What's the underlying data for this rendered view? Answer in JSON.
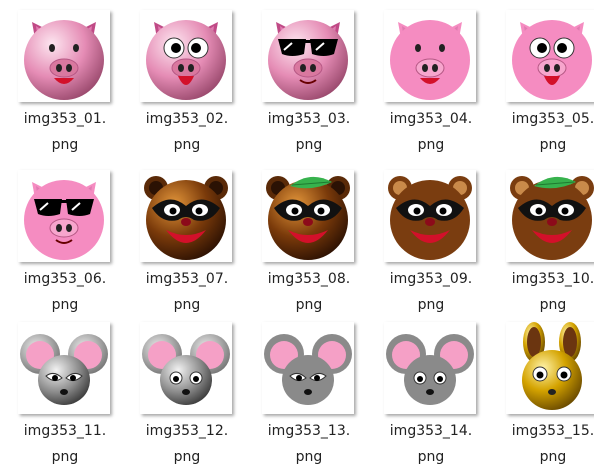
{
  "files": [
    {
      "name": "img353_01.",
      "ext": "png",
      "animal": "pig",
      "variant": "glossy-smile"
    },
    {
      "name": "img353_02.",
      "ext": "png",
      "animal": "pig",
      "variant": "glossy-googly-eyes"
    },
    {
      "name": "img353_03.",
      "ext": "png",
      "animal": "pig",
      "variant": "glossy-sunglasses"
    },
    {
      "name": "img353_04.",
      "ext": "png",
      "animal": "pig",
      "variant": "flat-smile"
    },
    {
      "name": "img353_05.",
      "ext": "png",
      "animal": "pig",
      "variant": "flat-googly-eyes"
    },
    {
      "name": "img353_06.",
      "ext": "png",
      "animal": "pig",
      "variant": "flat-sunglasses"
    },
    {
      "name": "img353_07.",
      "ext": "png",
      "animal": "tanuki",
      "variant": "glossy"
    },
    {
      "name": "img353_08.",
      "ext": "png",
      "animal": "tanuki",
      "variant": "glossy-leaf"
    },
    {
      "name": "img353_09.",
      "ext": "png",
      "animal": "tanuki",
      "variant": "flat"
    },
    {
      "name": "img353_10.",
      "ext": "png",
      "animal": "tanuki",
      "variant": "flat-leaf"
    },
    {
      "name": "img353_11.",
      "ext": "png",
      "animal": "mouse",
      "variant": "glossy"
    },
    {
      "name": "img353_12.",
      "ext": "png",
      "animal": "mouse",
      "variant": "glossy-round-eyes"
    },
    {
      "name": "img353_13.",
      "ext": "png",
      "animal": "mouse",
      "variant": "flat"
    },
    {
      "name": "img353_14.",
      "ext": "png",
      "animal": "mouse",
      "variant": "flat-round-eyes"
    },
    {
      "name": "img353_15.",
      "ext": "png",
      "animal": "gold-rabbit",
      "variant": "glossy"
    }
  ],
  "colors": {
    "pig_pink": "#f490c0",
    "tanuki_brown": "#7a3d10",
    "mouse_gray": "#808080",
    "gold": "#d7a300"
  }
}
